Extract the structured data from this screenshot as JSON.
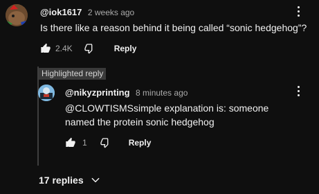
{
  "comment": {
    "handle": "@iok1617",
    "time": "2 weeks ago",
    "text": "Is there like a reason behind it being called “sonic hedgehog”?",
    "likes": "2.4K",
    "reply_label": "Reply"
  },
  "highlighted_reply": {
    "badge": "Highlighted reply",
    "handle": "@nikyzprinting",
    "time": "8 minutes ago",
    "text": "@CLOWTISMSsimple explanation is: someone named the protein sonic hedgehog",
    "likes": "1",
    "reply_label": "Reply"
  },
  "replies_toggle": {
    "label": "17 replies"
  },
  "colors": {
    "background": "#0f0f0f",
    "text_primary": "#f1f1f1",
    "text_secondary": "#aaaaaa",
    "badge_bg": "#3a3a3a"
  },
  "icons": [
    "more-vert-icon",
    "thumb-up-icon",
    "thumb-down-icon",
    "chevron-down-icon"
  ]
}
